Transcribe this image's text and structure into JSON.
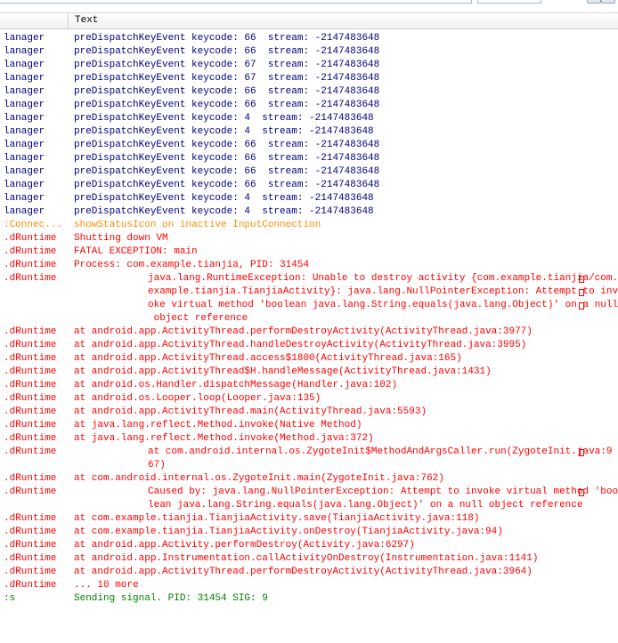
{
  "header": {
    "text_column": "Text"
  },
  "colors": {
    "debug": "#000080",
    "warn": "#ff8c00",
    "error": "#ff0000",
    "info": "#007f00"
  },
  "rows": [
    {
      "tag": "lanager",
      "msg": [
        "preDispatchKeyEvent keycode: 66  stream: -2147483648"
      ]
    },
    {
      "tag": "lanager",
      "msg": [
        "preDispatchKeyEvent keycode: 66  stream: -2147483648"
      ]
    },
    {
      "tag": "lanager",
      "msg": [
        "preDispatchKeyEvent keycode: 67  stream: -2147483648"
      ]
    },
    {
      "tag": "lanager",
      "msg": [
        "preDispatchKeyEvent keycode: 67  stream: -2147483648"
      ]
    },
    {
      "tag": "lanager",
      "msg": [
        "preDispatchKeyEvent keycode: 66  stream: -2147483648"
      ]
    },
    {
      "tag": "lanager",
      "msg": [
        "preDispatchKeyEvent keycode: 66  stream: -2147483648"
      ]
    },
    {
      "tag": "lanager",
      "msg": [
        "preDispatchKeyEvent keycode: 4  stream: -2147483648"
      ]
    },
    {
      "tag": "lanager",
      "msg": [
        "preDispatchKeyEvent keycode: 4  stream: -2147483648"
      ]
    },
    {
      "tag": "lanager",
      "msg": [
        "preDispatchKeyEvent keycode: 66  stream: -2147483648"
      ]
    },
    {
      "tag": "lanager",
      "msg": [
        "preDispatchKeyEvent keycode: 66  stream: -2147483648"
      ]
    },
    {
      "tag": "lanager",
      "msg": [
        "preDispatchKeyEvent keycode: 66  stream: -2147483648"
      ]
    },
    {
      "tag": "lanager",
      "msg": [
        "preDispatchKeyEvent keycode: 66  stream: -2147483648"
      ]
    },
    {
      "tag": "lanager",
      "msg": [
        "preDispatchKeyEvent keycode: 4  stream: -2147483648"
      ]
    },
    {
      "tag": "lanager",
      "msg": [
        "preDispatchKeyEvent keycode: 4  stream: -2147483648"
      ]
    },
    {
      "tag": ":Connec...",
      "msg": [
        "showStatusIcon on inactive InputConnection"
      ]
    },
    {
      "tag": ".dRuntime",
      "msg": [
        "Shutting down VM"
      ]
    },
    {
      "tag": ".dRuntime",
      "msg": [
        "FATAL EXCEPTION: main"
      ]
    },
    {
      "tag": ".dRuntime",
      "msg": [
        "Process: com.example.tianjia, PID: 31454"
      ]
    },
    {
      "tag": ".dRuntime",
      "msg": [
        "java.lang.RuntimeException: Unable to destroy activity {com.example.tianjia/com.",
        "example.tianjia.TianjiaActivity}: java.lang.NullPointerException: Attempt to inv",
        "oke virtual method 'boolean java.lang.String.equals(java.lang.Object)' on a null",
        " object reference"
      ]
    },
    {
      "tag": ".dRuntime",
      "msg": [
        "at android.app.ActivityThread.performDestroyActivity(ActivityThread.java:3977)"
      ]
    },
    {
      "tag": ".dRuntime",
      "msg": [
        "at android.app.ActivityThread.handleDestroyActivity(ActivityThread.java:3995)"
      ]
    },
    {
      "tag": ".dRuntime",
      "msg": [
        "at android.app.ActivityThread.access$1800(ActivityThread.java:165)"
      ]
    },
    {
      "tag": ".dRuntime",
      "msg": [
        "at android.app.ActivityThread$H.handleMessage(ActivityThread.java:1431)"
      ]
    },
    {
      "tag": ".dRuntime",
      "msg": [
        "at android.os.Handler.dispatchMessage(Handler.java:102)"
      ]
    },
    {
      "tag": ".dRuntime",
      "msg": [
        "at android.os.Looper.loop(Looper.java:135)"
      ]
    },
    {
      "tag": ".dRuntime",
      "msg": [
        "at android.app.ActivityThread.main(ActivityThread.java:5593)"
      ]
    },
    {
      "tag": ".dRuntime",
      "msg": [
        "at java.lang.reflect.Method.invoke(Native Method)"
      ]
    },
    {
      "tag": ".dRuntime",
      "msg": [
        "at java.lang.reflect.Method.invoke(Method.java:372)"
      ]
    },
    {
      "tag": ".dRuntime",
      "msg": [
        "at com.android.internal.os.ZygoteInit$MethodAndArgsCaller.run(ZygoteInit.java:9",
        "67)"
      ]
    },
    {
      "tag": ".dRuntime",
      "msg": [
        "at com.android.internal.os.ZygoteInit.main(ZygoteInit.java:762)"
      ]
    },
    {
      "tag": ".dRuntime",
      "msg": [
        "Caused by: java.lang.NullPointerException: Attempt to invoke virtual method 'boo",
        "lean java.lang.String.equals(java.lang.Object)' on a null object reference"
      ]
    },
    {
      "tag": ".dRuntime",
      "msg": [
        "at com.example.tianjia.TianjiaActivity.save(TianjiaActivity.java:118)"
      ]
    },
    {
      "tag": ".dRuntime",
      "msg": [
        "at com.example.tianjia.TianjiaActivity.onDestroy(TianjiaActivity.java:94)"
      ]
    },
    {
      "tag": ".dRuntime",
      "msg": [
        "at android.app.Activity.performDestroy(Activity.java:6297)"
      ]
    },
    {
      "tag": ".dRuntime",
      "msg": [
        "at android.app.Instrumentation.callActivityOnDestroy(Instrumentation.java:1141)"
      ]
    },
    {
      "tag": ".dRuntime",
      "msg": [
        "at android.app.ActivityThread.performDestroyActivity(ActivityThread.java:3964)"
      ]
    },
    {
      "tag": ".dRuntime",
      "msg": [
        "... 10 more"
      ]
    },
    {
      "tag": ":s",
      "msg": [
        "Sending signal. PID: 31454 SIG: 9"
      ]
    }
  ]
}
